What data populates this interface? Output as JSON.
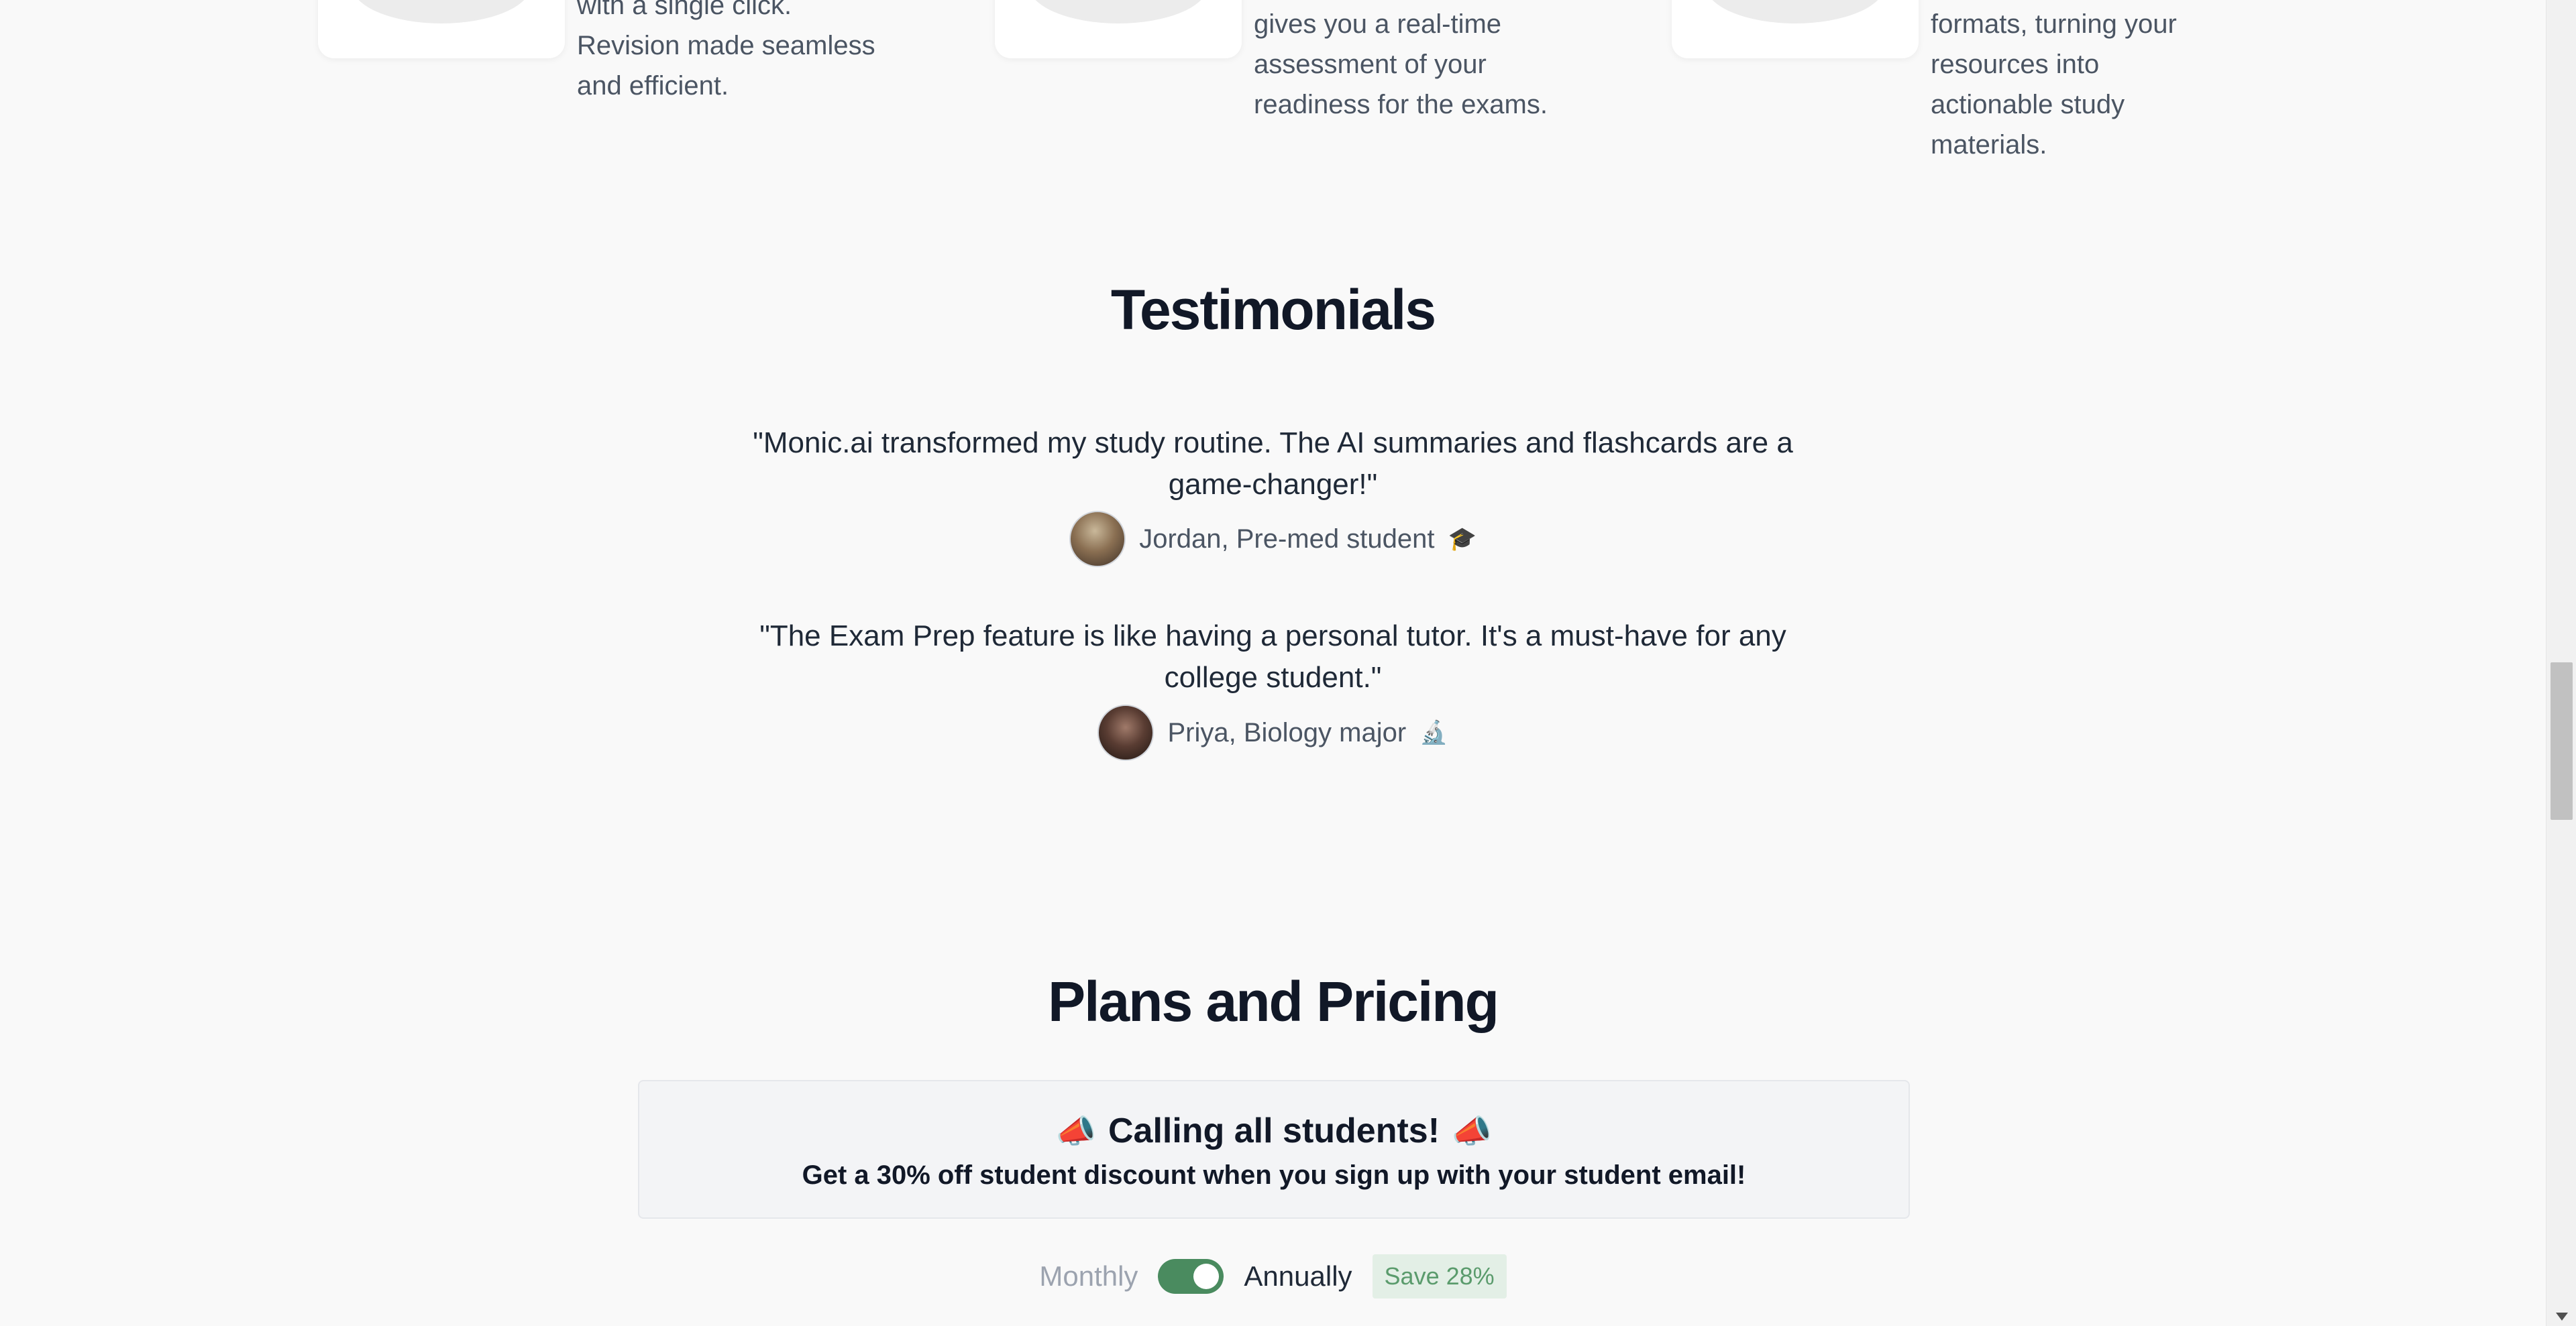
{
  "features": [
    {
      "text": "with a single click.\nRevision made seamless\nand efficient."
    },
    {
      "text": "gives you a real-time\nassessment of your\nreadiness for the exams."
    },
    {
      "text": "formats, turning your\nresources into\nactionable study\nmaterials."
    }
  ],
  "testimonials": {
    "title": "Testimonials",
    "items": [
      {
        "quote": "\"Monic.ai transformed my study routine. The AI summaries and flashcards are a game-changer!\"",
        "author": "Jordan, Pre-med student",
        "emoji": "🎓"
      },
      {
        "quote": "\"The Exam Prep feature is like having a personal tutor. It's a must-have for any college student.\"",
        "author": "Priya, Biology major",
        "emoji": "🔬"
      }
    ]
  },
  "pricing": {
    "title": "Plans and Pricing",
    "promo_icon": "📣",
    "promo_heading": "Calling all students!",
    "promo_subtext": "Get a 30% off student discount when you sign up with your student email!",
    "monthly_label": "Monthly",
    "annually_label": "Annually",
    "save_badge": "Save 28%",
    "billing_annual_selected": true
  },
  "colors": {
    "toggle_active": "#4a8b5f",
    "badge_bg": "#e3efe6",
    "badge_text": "#5a9b6c"
  }
}
